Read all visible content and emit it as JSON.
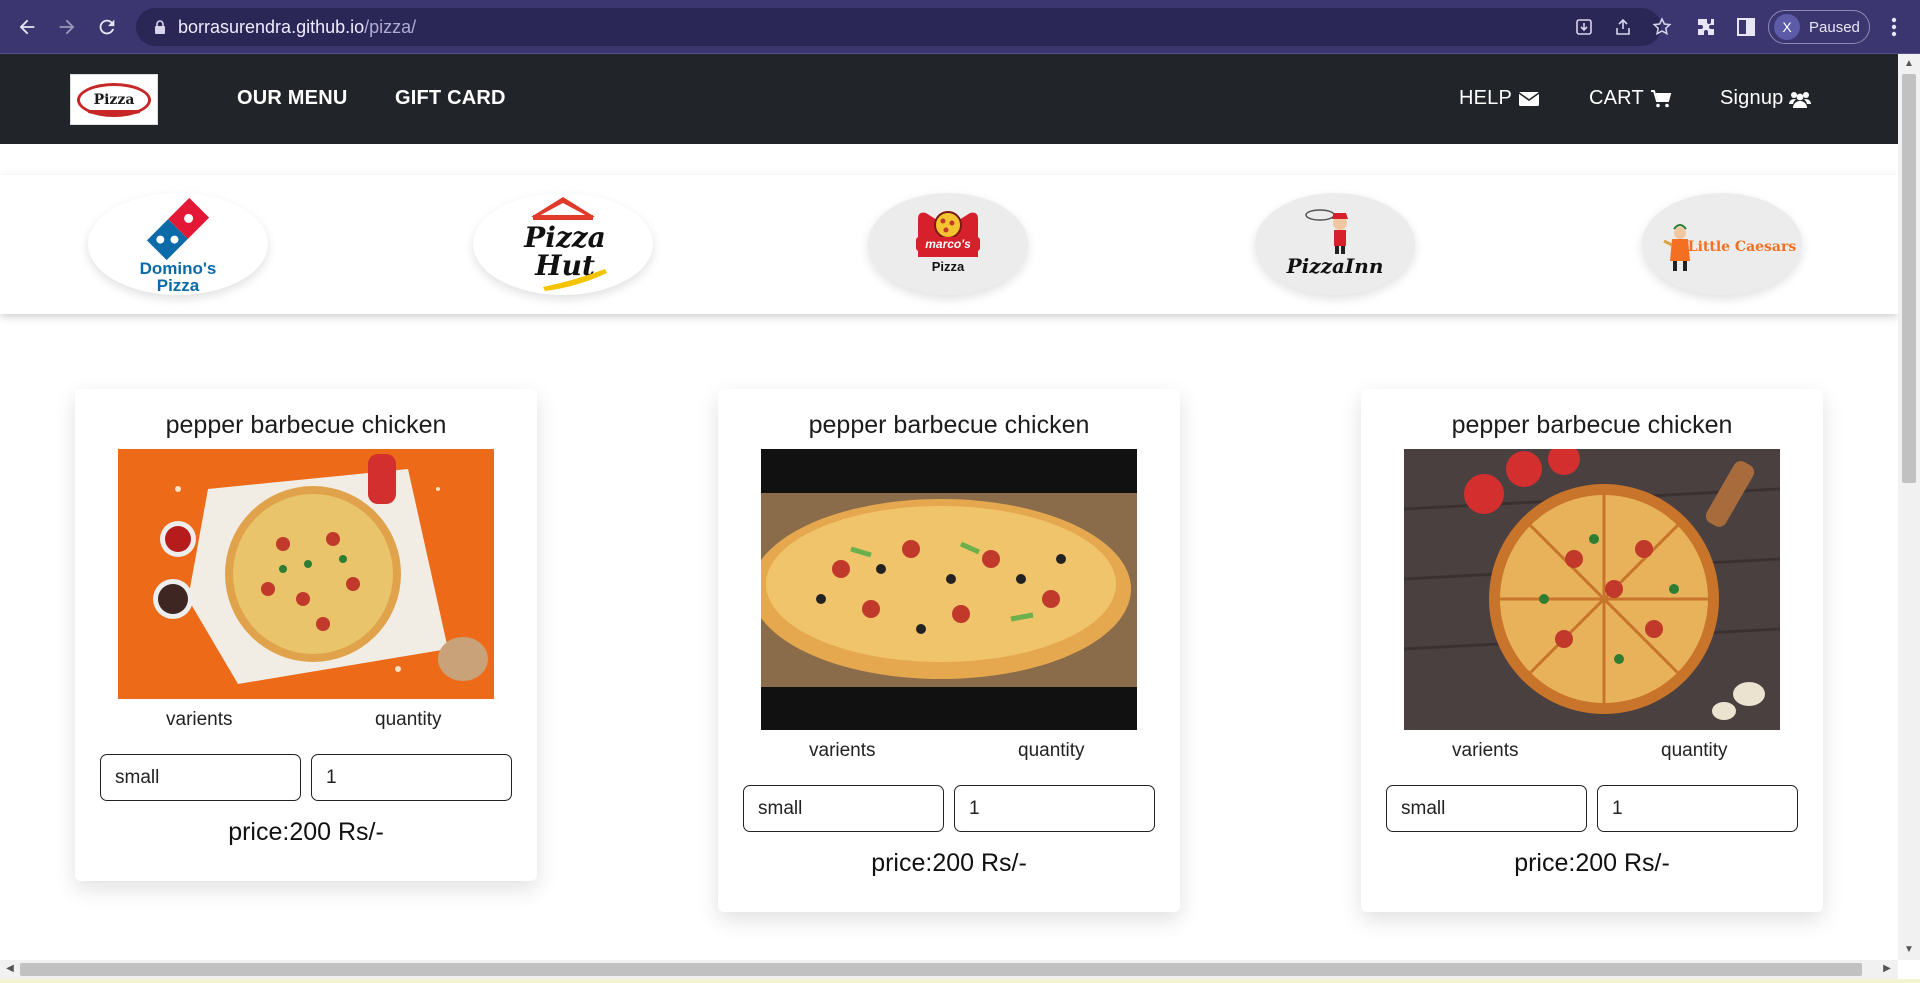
{
  "browser": {
    "url_host": "borrasurendra.github.io",
    "url_path": "/pizza/",
    "profile_initial": "X",
    "profile_status": "Paused"
  },
  "nav": {
    "logo_text": "Pizza",
    "links": [
      "OUR MENU",
      "GIFT CARD"
    ],
    "help_label": "HELP",
    "cart_label": "CART",
    "signup_label": "Signup"
  },
  "brands": [
    {
      "name": "Domino's Pizza",
      "line1": "Domino's",
      "line2": "Pizza",
      "icon": "dominos-logo"
    },
    {
      "name": "Pizza Hut",
      "line1": "Pizza",
      "line2": "Hut",
      "icon": "pizza-hut-logo"
    },
    {
      "name": "Marco's Pizza",
      "line1": "marco's",
      "line2": "Pizza",
      "icon": "marcos-logo"
    },
    {
      "name": "Pizza Inn",
      "line1": "PizzaInn",
      "icon": "pizza-inn-logo"
    },
    {
      "name": "Little Caesars",
      "line1": "Little Caesars",
      "icon": "little-caesars-logo"
    }
  ],
  "cards": [
    {
      "title": "pepper barbecue chicken",
      "variants_label": "varients",
      "quantity_label": "quantity",
      "variant_value": "small",
      "quantity_value": "1",
      "price": "price:200 Rs/-"
    },
    {
      "title": "pepper barbecue chicken",
      "variants_label": "varients",
      "quantity_label": "quantity",
      "variant_value": "small",
      "quantity_value": "1",
      "price": "price:200 Rs/-"
    },
    {
      "title": "pepper barbecue chicken",
      "variants_label": "varients",
      "quantity_label": "quantity",
      "variant_value": "small",
      "quantity_value": "1",
      "price": "price:200 Rs/-"
    }
  ],
  "colors": {
    "chrome_bg": "#3b3670",
    "navbar_bg": "#212529",
    "dominos_blue": "#0b6ba8",
    "dominos_red": "#e31837",
    "pizza_hut_red": "#e03a2a",
    "little_caesars_orange": "#f36f21"
  }
}
